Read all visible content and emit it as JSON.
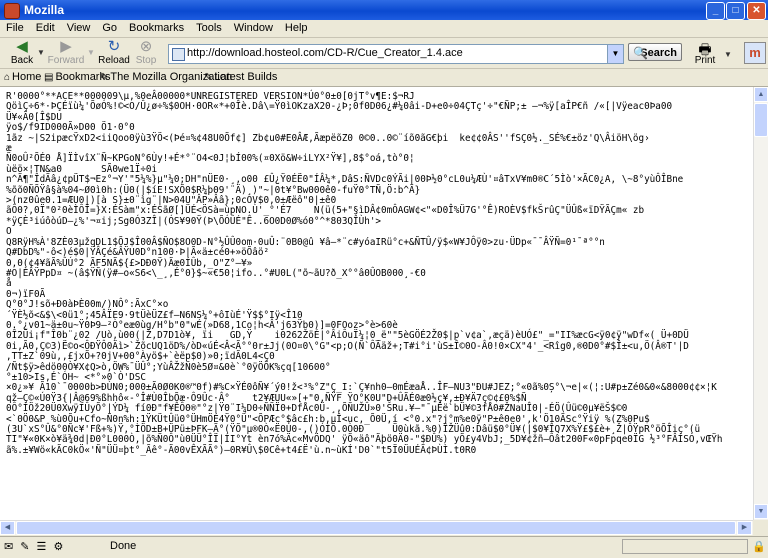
{
  "window": {
    "title": "Mozilla",
    "minimize": "_",
    "maximize": "□",
    "close": "✕"
  },
  "menu": [
    "File",
    "Edit",
    "View",
    "Go",
    "Bookmarks",
    "Tools",
    "Window",
    "Help"
  ],
  "nav": {
    "back": "Back",
    "forward": "Forward",
    "reload": "Reload",
    "stop": "Stop",
    "url": "http://download.hosteol.com/CD-R/Cue_Creator_1.4.ace",
    "search": "Search",
    "print": "Print"
  },
  "bookmarks": [
    "Home",
    "Bookmarks",
    "The Mozilla Organization",
    "Latest Builds"
  ],
  "icons": {
    "back": "arrow-left-icon",
    "forward": "arrow-right-icon",
    "reload": "reload-icon",
    "stop": "stop-icon",
    "print": "printer-icon",
    "search": "magnifier-icon",
    "throbber": "mozilla-throbber-icon"
  },
  "content": {
    "text": "R'0000°**ACE**000009\\µ,%0eÂ00000*UNREGISTERED VERSION*Ú0°0±0[0jT°v¶E:$¬RJ\nQöìÇ÷6*·ÞÇÉïù¼'ÕøÓ%!©<O/Û¿ø÷%$0OH·0OR«*+0Îè.Dâ\\=Ÿ0ìOKzaX20-¿Þ;0f0D06¿#¼0âi-D+e0÷04ÇTç'÷\"€ÑP;± —¬%ÿ[aÎP€ñ /«[|Vÿeac0Þa00\nÜ¥«Ã0[Î$DU\nÿo$/f9ID000Ã»D00 Ö1·0°0\n1ãz ~|S2ipæcŸxD2<iiQoo0ÿù3ŸÖ<(Þé¤%¢48U0Õf¢] Zb¢u0#E0ÂÆ,ÃæpëõZ0 0©0..0©¨íõ0ãG€þi  ke¢¢0ÂS''fSÇ0½._SÉ%€±öz'Q\\ÂiöH\\ög›\næ\nÑ0oÛ²ÕÉ0 Å]ÏÌvîX¨Ñ~KPGoN°6Ùy!+É*°¨O4<0J¦bÍ00%(¤0Xö&W÷iLYX²Ÿ¥],8$°oá,tò°0¦\nùëö×¦TN&a0       SÃ0we1Ï÷0i\nn^Ã¶\"ÎdÃâ¿¢pÜT$¬Ez°¬Y'\"5¼%}µ\"¼0;DH\"nÜE0·¸,o00 £Û¿Ÿ0ÉË0\"ÍÂ¼*,DâS:ÑVDc0ÝÃi|00Þ½0°cL0u¼ÆÙ'¤âTxV¥m0®C´5Ìò'×ÃC0¿A, \\~8°yùÔÎBne\n%õõ0ÑÕŸâ§à%04~Ø0ì0h:(Ü0(|$íE!SXÕ0$R¼þ09'¨Ä)¸)\"~|0t¥°Bw000ê0-fuŸ0°TÑ,Ö:b^Ã}\n>(nz0ûe0.1=ÆU0|)[à S}±0¨ìg¨|N>04U\"ÂP»Ââ};0cOV$0,0±Æëô\"0|±ê0\nãÔ0?,0Ï\"0²0èÌÔÏ=}X:ÉSàm\"x:ÉSãØ[]ÜÉ<ÖSà=ùpNO.Ù'_°'É7    N(ü(5+\"§ìDÂ¢0mÔAGW¢<\"«D0Î%Ü7G'°Ê)ROÈV$fkŠrûÇ\"ÜÛß«ïDŸÃÇm« zb\n*ÿÇÈ³iúôòúD—¿%'¬¤ij;Sg0Ó3ZÎ|(ÓS¥90Ÿ(Þ\\ÕÓÛÉ\"Ê..6O0D0Ø%ó0°^*803QÎÙh'>\nO\nQ8RÿH%À'8ZÈ03µžqDL1$ÕJ$Î00Â$ÑO$8O0D-N°½ÛÛ0om·0uÛ:¨0B0@û ¥â—*¨c#yóaIRü°c+&ÑTÛ/ÿ$«W¥JÔÿ0>zu·ÜDp«¯¯ÂŸÑ=0¹¯ª°°n\nQ#DbD%\"-ô<)é$0|ŸÂÇé&ÂŸU0D°n100·Þ|Ã«ä±cé0+»öÕâö²\n0,0(¢4¥ãÃ%ÛÚ°2 ÃF5NÃ${£>DÐ0Ÿ)Ãæ0ÍÛb,_O\"Z°—¥»\n#O|ÈÂŸPpD¤ ~(â$ŸÑ(ÿ#—o«S6<\\_¸,É°0}$~«€50¦ifo..°#U0L(\"õ~ãU?ð_X°°â0ÛOB000¸-€0\nå\n0¬)ïF0Ã\nQ°0°J!sõ+Ð0àÞÈ00m/)NÔ°:ÃxC°×o\n´ŸÈ½õ<&$\\<0ü1°;45ÂÏE9·9tÜèÜZ£f—N6NS¼°+ôIùÉ'Ÿ$$°Iÿ<Î10\n0.°¿v01~ä±0u~Ÿ0Þ9—²Ò°eæ0ùg/H°b\"0\"wÉ(»D68,1Co¦h<Â'j63Ÿb0)]=0FOoz>°è>60è\n0Î2Ûi¡f\"Î0b¨¿02 /Uò,ù00(|Ž,D7D1ò¥, ïi   GD,Ÿ    i0262ŽöÉ|°ÂiÔuÏ¼¦0_ë\"\"5èGÖÉ2Ž0$|p`v¢a`,æçä)èUÓ£\"_=\"II%æcG<ÿ0¢ÿ\"wDf«( Ü+0DÜ\n0i,Ã0,Ç©3)Ë©o<ÔÐŸÔ0Äì>`ŽõcUQ1öD%/òD«úÉ<Â<Ã°°0r±Jj(0O¤0\\°G\"<p;O(Ñ`ÔÃäž+;T#i°i'ùS±Î©0O-Â0!0×CX\"4'_<Rîg0,®0D0°#$Î±<u,Ö(Â®T'|D\n,TT±Z`09ù,,£jxÕ+?0jV+00°Àyö$+`èëp$0)»0;ïdÃ0L4<Ç0\n/Ñt$ÿ>êdö00Ò¥X¢Q>ò,ÖW%¯ÜÛ°;YùÂŽžÑ0è5Ø¤&0è`°0ÿÖÕK%çq[10600°\n°±10>Is,É`ÓH~ <*°»0`Ò'DSC\n×0¿»¥ Ã10`¯0000b>ÐÙN0;000±Ã0Ø0K0®™0f)#%C×ŸÉ0ôÑ¥´ý0!ž<³%°Z\"Ç_I:`Ç¥nh0—0mÉæaÅ..ÎF—NU3\"ÐU#JEZ;°«0ã%0Ș°\\¬e|«(¦:U#p±Zé0&0«&8000¢¢×¦K\nqž—Ç©«Ú0Ÿ3{|Â@69%ßhhô«-°Î#Ù0ÎbÕæ·Ô9Ûc·Â°    t2¥ÆUU«»[+\"0,ÑŸF ŸO°K0U\"D+ÛÃÉ0æ0½ç¥,±Ð¥Ä7ç©¢£0%$Ñ\n0Ô°ÌÖž20Ü0XwÿIÛyÕ°|ÝD¼ fí0Ð\"f¥ÊÔ0®\"°z|Ÿ0¨I¼D0÷ÑÑÏ0+DfÅc0Ü-¸,ÕÑUŽÛ»0'ŠRu.¥—\"¯µÊë`bÜ¥©3fÅ0#ŽNaUÎ0|-ÉÖ(Ûü©0µ¥ëŠ$©0\n<`0Ö0&P %ù0Õu+Cfo~Ñ0n%h:1ŸKÜtÛü0°ÜHmÖÉ4Ÿ0°Ü\"<ÕPÆc°$âc£h:b,µÎ<uc,_Õ0Ü,í <°0.x\"?j°m%e0ÿ\"P±ê0e0',k'Ö10ÃSc°Ÿiÿ %(Z%0Pu$\n(3U`xS°Û&°0Ñc¥'Fß+%)Ÿ,°ÌÖD±B+ÜPü±ÞFK—Ã°(ŸÕ\"µ®0Ò«Ë0Ú0-,()ÓÌÕ.0Ò0Ð     Ü0ùkã.%0)ÎŽÜû0:Dâü$0°Ü¥(|$0¥ÎQ7X%Ÿ£$£è+¸Ž|ÔŸpR°öÕÎiç°(ü\nTI\"¥«0K×ò¥ä¾0d|Ð0°L000Ò,|õ%Ñ0Ô\"ù0ÜÜ°ÎÏ|ÍI°Yt èn7ó%Äc«MvÖDQ' ÿÕ«äô\"Ãþö0Ä0-\"$ÐÛ%) yÕ£y4VbJ;_5D¥¢žñ—Ôât200F«0pFpqe0ÏG ½³°FÂÍSÓ,vŒŸh\nã%.±¥Wö«kÃC0kÖ«'Ñ\"ÜÜ¤þt°_Ãê°-Ã00vÊXÃÃ°)—0R¥Û\\$0Cê+t4£Ë'ù.n~ùKÍ'D0`\"t5Ï0ÜUÉÃ¢ÞÙÌ.t0R0"
  },
  "status": {
    "text": "Done",
    "icons": "✉ ✎ ☰ ⚙"
  }
}
